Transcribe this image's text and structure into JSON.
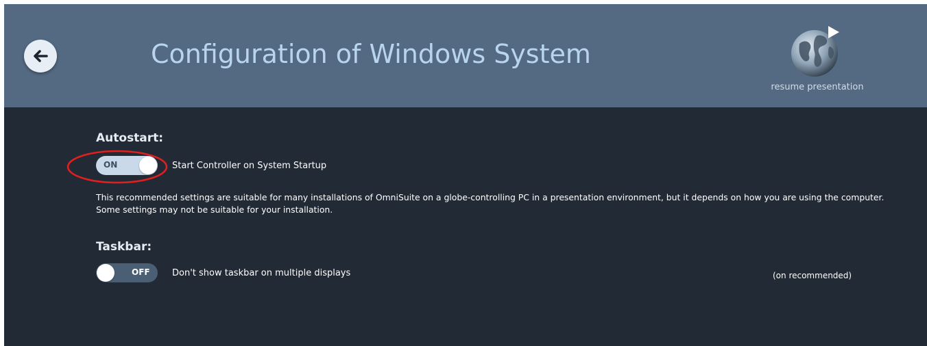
{
  "header": {
    "title": "Configuration of Windows System",
    "back_icon": "arrow-left-icon",
    "resume_label": "resume presentation",
    "resume_icon": "globe-play-icon"
  },
  "autostart": {
    "title": "Autostart:",
    "toggle_state": "ON",
    "description": "Start Controller on System Startup"
  },
  "info_text": "This recommended settings are suitable for many installations of OmniSuite on a globe-controlling PC in a presentation environment, but it depends on how you are using the computer. Some settings may not be suitable for your installation.",
  "taskbar": {
    "title": "Taskbar:",
    "toggle_state": "OFF",
    "description": "Don't show taskbar on multiple displays",
    "recommendation": "(on recommended)"
  },
  "colors": {
    "header_bg": "#536a82",
    "body_bg": "#212a35",
    "title_color": "#b9d4ee",
    "highlight": "#e02020"
  }
}
